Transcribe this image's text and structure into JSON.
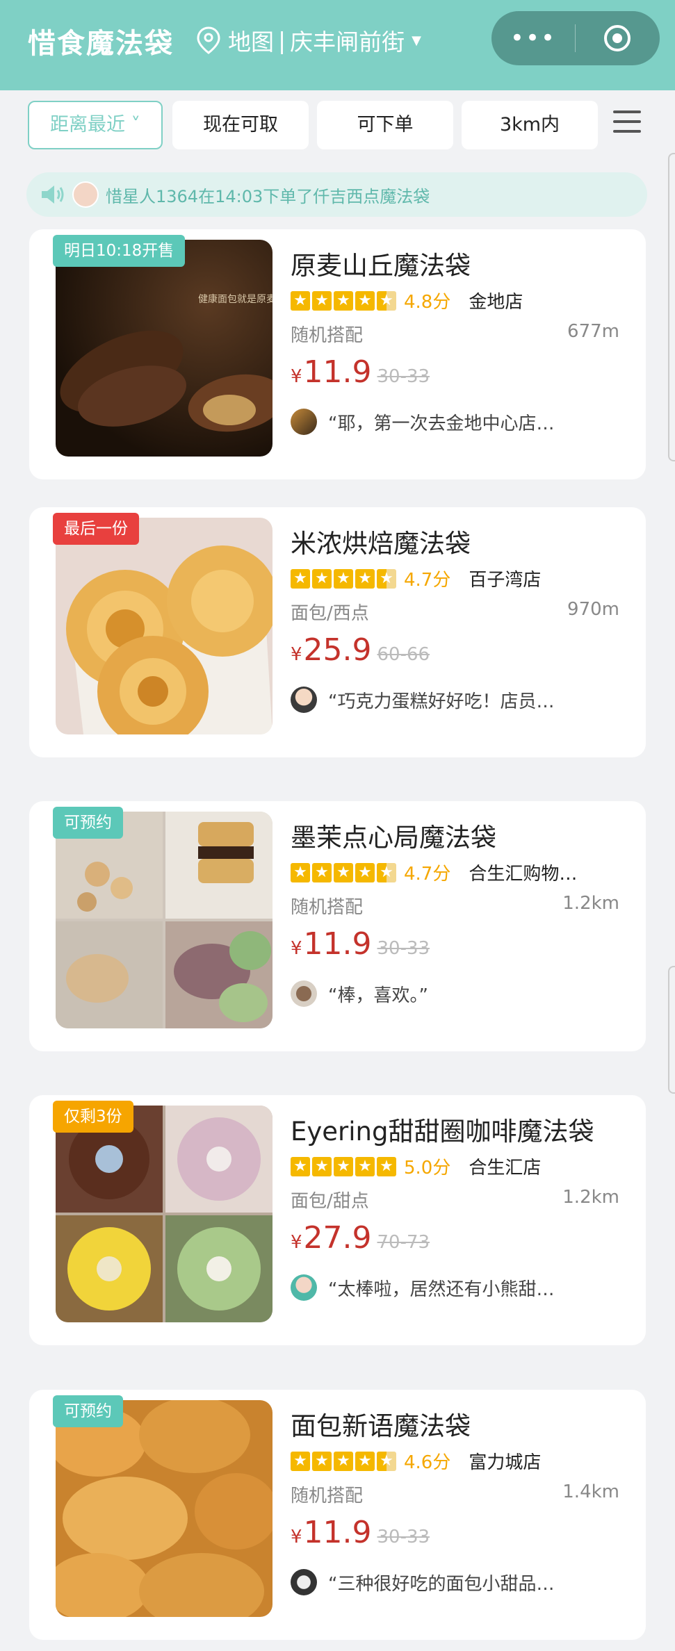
{
  "header": {
    "app_title": "惜食魔法袋",
    "map_label": "地图",
    "separator": "|",
    "location": "庆丰闸前街",
    "more_glyph": "•••"
  },
  "filters": [
    {
      "label": "距离最近 ˅",
      "active": true
    },
    {
      "label": "现在可取",
      "active": false
    },
    {
      "label": "可下单",
      "active": false
    },
    {
      "label": "3km内",
      "active": false
    }
  ],
  "ticker": {
    "text": "惜星人1364在14:03下单了仟吉西点魔法袋"
  },
  "colors": {
    "brand": "#7fd0c5",
    "price": "#c4322b",
    "star": "#f5b800",
    "teal_badge": "#5cc8b8",
    "red_badge": "#e8403e",
    "orange_badge": "#f6a500"
  },
  "cards": [
    {
      "badge": "明日10:18开售",
      "badge_color": "#5cc8b8",
      "title": "原麦山丘魔法袋",
      "stars": 4.5,
      "score": "4.8分",
      "branch": "金地店",
      "category": "随机搭配",
      "distance": "677m",
      "currency": "¥",
      "price": "11.9",
      "original": "30-33",
      "review": "“耶，第一次去金地中心店…",
      "image_text": "健康面包就是原麦山丘"
    },
    {
      "badge": "最后一份",
      "badge_color": "#e8403e",
      "title": "米浓烘焙魔法袋",
      "stars": 4.5,
      "score": "4.7分",
      "branch": "百子湾店",
      "category": "面包/西点",
      "distance": "970m",
      "currency": "¥",
      "price": "25.9",
      "original": "60-66",
      "review": "“巧克力蛋糕好好吃！店员…"
    },
    {
      "badge": "可预约",
      "badge_color": "#5cc8b8",
      "title": "墨茉点心局魔法袋",
      "stars": 4.5,
      "score": "4.7分",
      "branch": "合生汇购物…",
      "category": "随机搭配",
      "distance": "1.2km",
      "currency": "¥",
      "price": "11.9",
      "original": "30-33",
      "review": "“棒，喜欢。”"
    },
    {
      "badge": "仅剩3份",
      "badge_color": "#f6a500",
      "title": "Eyering甜甜圈咖啡魔法袋",
      "stars": 5,
      "score": "5.0分",
      "branch": "合生汇店",
      "category": "面包/甜点",
      "distance": "1.2km",
      "currency": "¥",
      "price": "27.9",
      "original": "70-73",
      "review": "“太棒啦，居然还有小熊甜…"
    },
    {
      "badge": "可预约",
      "badge_color": "#5cc8b8",
      "title": "面包新语魔法袋",
      "stars": 4.5,
      "score": "4.6分",
      "branch": "富力城店",
      "category": "随机搭配",
      "distance": "1.4km",
      "currency": "¥",
      "price": "11.9",
      "original": "30-33",
      "review": "“三种很好吃的面包小甜品…"
    }
  ]
}
